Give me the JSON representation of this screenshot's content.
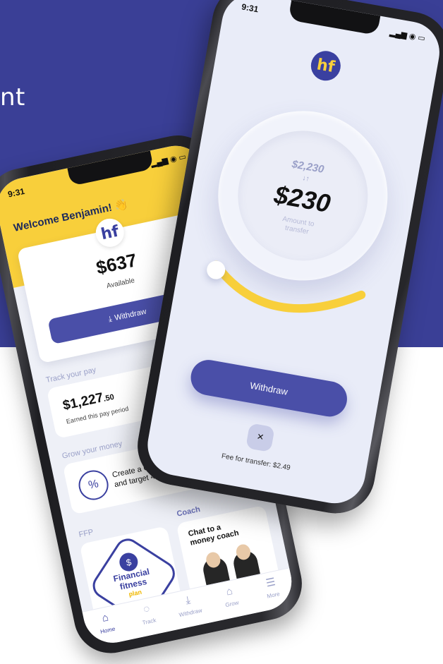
{
  "background": {
    "top_color": "#3a3f96",
    "bottom_color": "#ffffff",
    "partial_text": "nt"
  },
  "left_phone": {
    "status": {
      "time": "9:31",
      "icons": "signal-wifi-battery"
    },
    "welcome": "Welcome Benjamin! 👋",
    "balance_card": {
      "logo": "hf",
      "amount": "$637",
      "amount_label": "Available",
      "button_label": "Withdraw"
    },
    "track_pay": {
      "section_title": "Track your pay",
      "amount": "$1,227",
      "amount_cents": ".50",
      "subtitle": "Earned this pay period"
    },
    "grow_money": {
      "section_title": "Grow your money",
      "text_line1": "Create a Gro",
      "text_line2": "and target 4% p.a."
    },
    "ffp": {
      "section_title": "FFP",
      "text_line1": "Financial",
      "text_line2": "fitness",
      "text_line3": "plan"
    },
    "coach": {
      "section_title": "Coach",
      "card_title_line1": "Chat to a",
      "card_title_line2": "money coach"
    },
    "nav": [
      {
        "label": "Home",
        "icon": "home-icon"
      },
      {
        "label": "Track",
        "icon": "track-icon"
      },
      {
        "label": "Withdraw",
        "icon": "withdraw-icon"
      },
      {
        "label": "Grow",
        "icon": "grow-icon"
      },
      {
        "label": "More",
        "icon": "more-icon"
      }
    ],
    "colors": {
      "header": "#f8cf3b",
      "primary": "#4a4fa8"
    }
  },
  "right_phone": {
    "status": {
      "time": "9:31",
      "icons": "signal-wifi-battery"
    },
    "logo": "hf",
    "previous_amount": "$2,230",
    "amount": "$230",
    "amount_label_line1": "Amount to",
    "amount_label_line2": "transfer",
    "button_label": "Withdraw",
    "close_label": "×",
    "fee_text": "Fee for transfer: $2.49",
    "colors": {
      "slider": "#f8cf3b",
      "primary": "#4a4fa8"
    }
  }
}
